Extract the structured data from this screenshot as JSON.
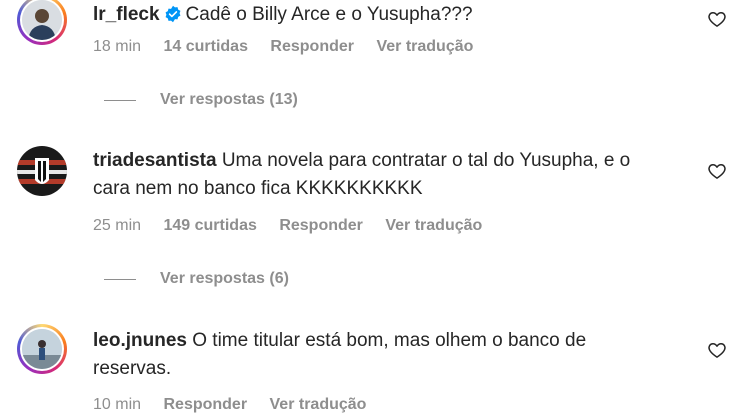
{
  "comments": [
    {
      "username": "lr_fleck",
      "verified": true,
      "text": "Cadê o Billy Arce e o Yusupha???",
      "time": "18 min",
      "likes": "14 curtidas",
      "reply_label": "Responder",
      "translate_label": "Ver tradução",
      "view_replies": "Ver respostas (13)"
    },
    {
      "username": "triadesantista",
      "verified": false,
      "text_line1": "Uma novela para contratar o tal do Yusupha, e o",
      "text_line2": "cara nem no banco fica KKKKKKKKKK",
      "time": "25 min",
      "likes": "149 curtidas",
      "reply_label": "Responder",
      "translate_label": "Ver tradução",
      "view_replies": "Ver respostas (6)"
    },
    {
      "username": "leo.jnunes",
      "verified": false,
      "text_line1": "O time titular está bom, mas olhem o banco de",
      "text_line2": "reservas.",
      "time": "10 min",
      "reply_label": "Responder",
      "translate_label": "Ver tradução"
    }
  ],
  "icons": {
    "like": "heart-outline-icon",
    "verified": "verified-badge-icon"
  },
  "colors": {
    "text": "#262626",
    "secondary": "#8e8e8e",
    "verified": "#0095f6"
  }
}
